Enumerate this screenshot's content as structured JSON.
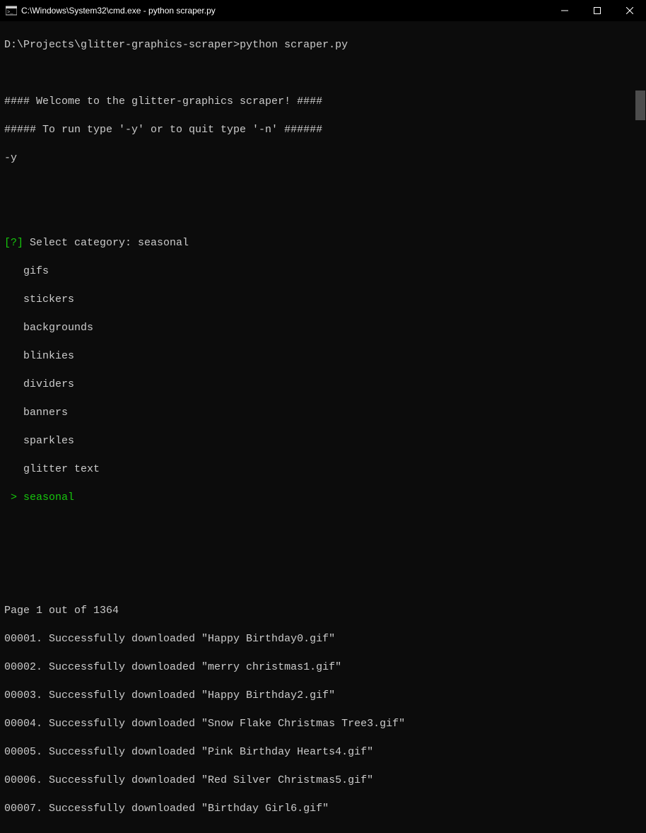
{
  "titlebar": {
    "title": "C:\\Windows\\System32\\cmd.exe - python  scraper.py"
  },
  "prompt": {
    "path": "D:\\Projects\\glitter-graphics-scraper>",
    "command": "python scraper.py"
  },
  "welcome": {
    "line1": "#### Welcome to the glitter-graphics scraper! ####",
    "line2": "##### To run type '-y' or to quit type '-n' ######",
    "input": "-y"
  },
  "select": {
    "prompt_prefix": "[?]",
    "prompt_text": " Select category: ",
    "selected_value": "seasonal",
    "options": [
      "gifs",
      "stickers",
      "backgrounds",
      "blinkies",
      "dividers",
      "banners",
      "sparkles",
      "glitter text"
    ],
    "cursor": " > ",
    "cursor_value": "seasonal"
  },
  "progress": {
    "pager": "Page 1 out of 1364",
    "downloads": [
      "00001. Successfully downloaded \"Happy Birthday0.gif\"",
      "00002. Successfully downloaded \"merry christmas1.gif\"",
      "00003. Successfully downloaded \"Happy Birthday2.gif\"",
      "00004. Successfully downloaded \"Snow Flake Christmas Tree3.gif\"",
      "00005. Successfully downloaded \"Pink Birthday Hearts4.gif\"",
      "00006. Successfully downloaded \"Red Silver Christmas5.gif\"",
      "00007. Successfully downloaded \"Birthday Girl6.gif\""
    ]
  }
}
